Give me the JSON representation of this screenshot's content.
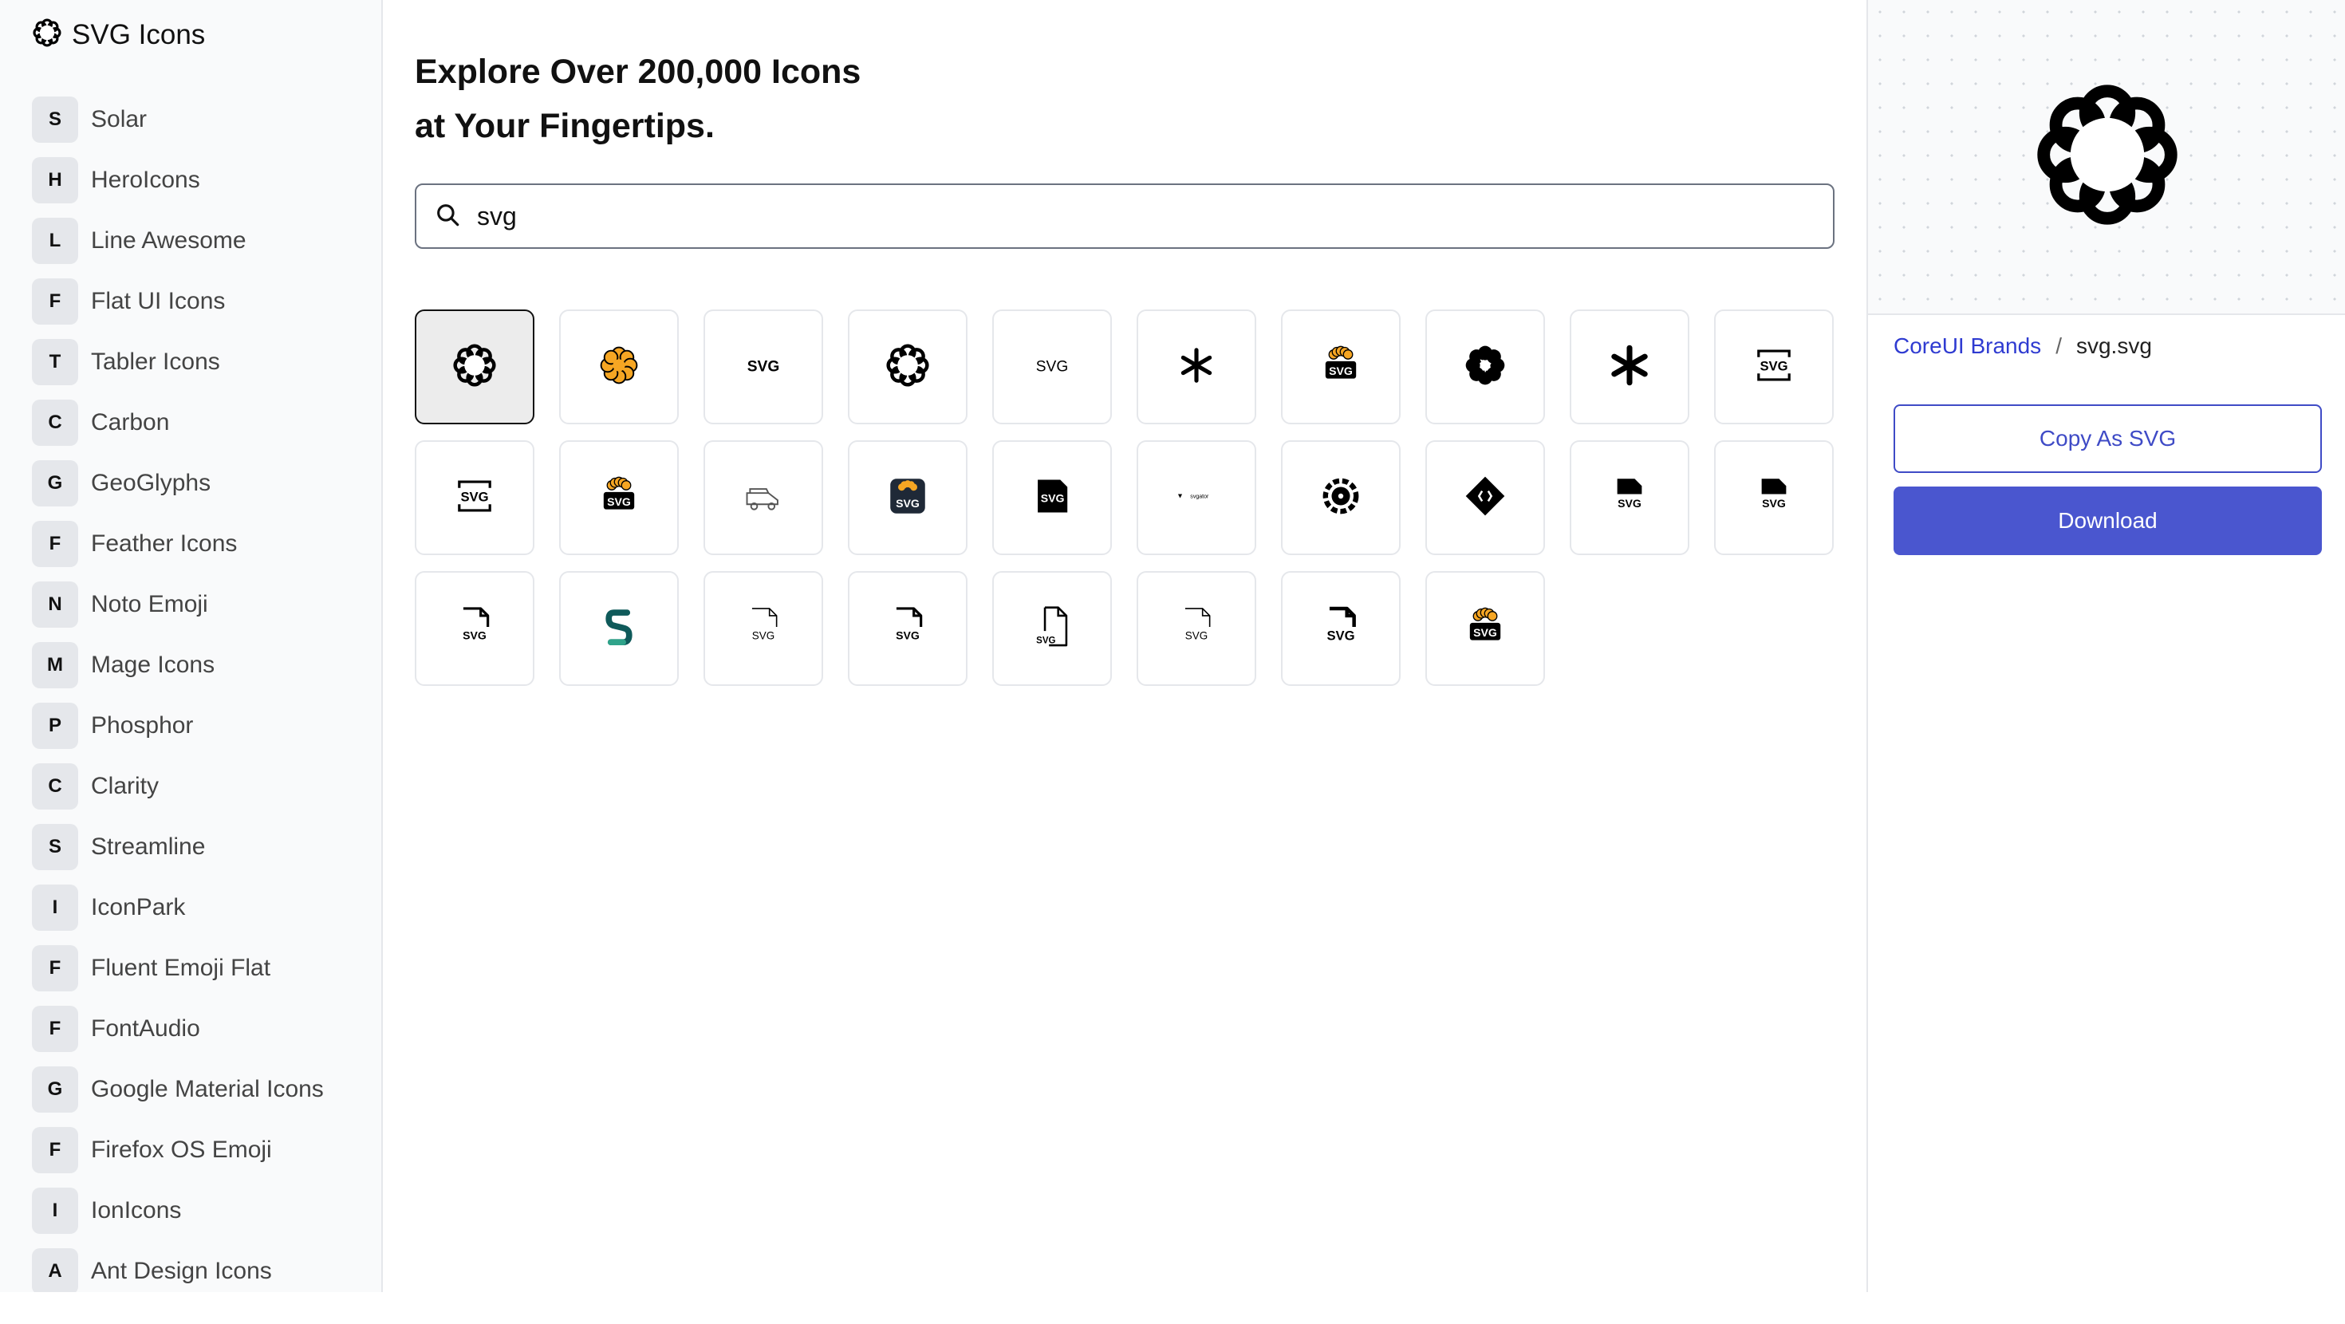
{
  "app": {
    "title": "SVG Icons",
    "logo_icon": "flower-icon"
  },
  "sidebar": {
    "items": [
      {
        "badge": "S",
        "label": "Solar"
      },
      {
        "badge": "H",
        "label": "HeroIcons"
      },
      {
        "badge": "L",
        "label": "Line Awesome"
      },
      {
        "badge": "F",
        "label": "Flat UI Icons"
      },
      {
        "badge": "T",
        "label": "Tabler Icons"
      },
      {
        "badge": "C",
        "label": "Carbon"
      },
      {
        "badge": "G",
        "label": "GeoGlyphs"
      },
      {
        "badge": "F",
        "label": "Feather Icons"
      },
      {
        "badge": "N",
        "label": "Noto Emoji"
      },
      {
        "badge": "M",
        "label": "Mage Icons"
      },
      {
        "badge": "P",
        "label": "Phosphor"
      },
      {
        "badge": "C",
        "label": "Clarity"
      },
      {
        "badge": "S",
        "label": "Streamline"
      },
      {
        "badge": "I",
        "label": "IconPark"
      },
      {
        "badge": "F",
        "label": "Fluent Emoji Flat"
      },
      {
        "badge": "F",
        "label": "FontAudio"
      },
      {
        "badge": "G",
        "label": "Google Material Icons"
      },
      {
        "badge": "F",
        "label": "Firefox OS Emoji"
      },
      {
        "badge": "I",
        "label": "IonIcons"
      },
      {
        "badge": "A",
        "label": "Ant Design Icons"
      }
    ]
  },
  "main": {
    "headline_line1": "Explore Over 200,000 Icons",
    "headline_line2": "at Your Fingertips.",
    "search": {
      "value": "svg",
      "icon": "search-icon"
    },
    "results": [
      {
        "icon": "flower-outline-icon",
        "selected": true
      },
      {
        "icon": "flower-orange-icon"
      },
      {
        "icon": "svg-text-bold-icon",
        "text": "SVG"
      },
      {
        "icon": "flower-outline-icon"
      },
      {
        "icon": "svg-text-light-icon",
        "text": "SVG"
      },
      {
        "icon": "asterisk-icon"
      },
      {
        "icon": "svg-badge-orange-icon",
        "text": "SVG"
      },
      {
        "icon": "flower-solid-icon"
      },
      {
        "icon": "asterisk-bold-icon"
      },
      {
        "icon": "svg-frame-icon",
        "text": "SVG"
      },
      {
        "icon": "svg-frame-icon",
        "text": "SVG"
      },
      {
        "icon": "svg-badge-orange-icon",
        "text": "SVG"
      },
      {
        "icon": "vehicle-outline-icon"
      },
      {
        "icon": "svg-badge-dark-icon",
        "text": "SVG"
      },
      {
        "icon": "svg-card-icon",
        "text": "SVG"
      },
      {
        "icon": "svgator-logo-icon",
        "text": "svgator"
      },
      {
        "icon": "gear-nodes-icon"
      },
      {
        "icon": "diamond-code-icon"
      },
      {
        "icon": "svg-file-solid-icon",
        "text": "SVG"
      },
      {
        "icon": "svg-file-solid-icon",
        "text": "SVG"
      },
      {
        "icon": "svg-file-outline-icon",
        "text": "SVG"
      },
      {
        "icon": "s-logo-green-icon"
      },
      {
        "icon": "svg-file-thin-icon",
        "text": "SVG"
      },
      {
        "icon": "svg-file-outline-icon",
        "text": "SVG"
      },
      {
        "icon": "svg-file-large-icon",
        "text": "SVG"
      },
      {
        "icon": "svg-file-thin-icon",
        "text": "SVG"
      },
      {
        "icon": "svg-file-bold-icon",
        "text": "SVG"
      },
      {
        "icon": "svg-badge-orange-icon",
        "text": "SVG"
      }
    ]
  },
  "panel": {
    "preview_icon": "flower-outline-icon",
    "collection": "CoreUI Brands",
    "separator": "/",
    "filename": "svg.svg",
    "copy_label": "Copy As SVG",
    "download_label": "Download",
    "colors": {
      "accent": "#4a56cf",
      "link": "#2f3bd1"
    }
  }
}
